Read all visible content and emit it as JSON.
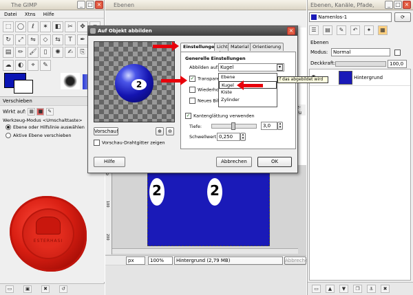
{
  "toolbox": {
    "title": "The GIMP",
    "menu": [
      "Datei",
      "Xtns",
      "Hilfe"
    ],
    "tools": [
      "rect-select",
      "ellipse-select",
      "lasso",
      "fuzzy-select",
      "color-select",
      "scissors",
      "move",
      "crop",
      "rotate",
      "scale",
      "shear",
      "perspective",
      "flip",
      "text",
      "color-picker",
      "bucket-fill",
      "blend",
      "pencil",
      "paintbrush",
      "eraser",
      "airbrush",
      "ink",
      "clone",
      "convolve",
      "smudge",
      "dodge",
      "measure",
      "path"
    ],
    "fg_color": "#0a14b4",
    "bg_color": "#ffffff"
  },
  "tool_options": {
    "title": "Verschieben",
    "affects_label": "Wirkt auf:",
    "tool_mode_label": "Werkzeug-Modus  <Umschalttaste>",
    "option_1": "Ebene oder Hilfslinie auswählen",
    "option_2": "Aktive Ebene verschieben",
    "wax_seal_text": "ESTERHASI"
  },
  "top_window": {
    "title": "Ebenen"
  },
  "dialog": {
    "title": "Auf Objekt abbilden",
    "tabs": [
      "Einstellungen",
      "Licht",
      "Material",
      "Orientierung"
    ],
    "section_heading": "Generelle Einstellungen",
    "map_to_label": "Abbilden auf:",
    "map_to_value": "Kugel",
    "dropdown_options": [
      "Ebene",
      "Kugel",
      "Kiste",
      "Zylinder"
    ],
    "tooltip": "f das abgebildet wird",
    "checkbox_transparent": "Transpare",
    "checkbox_tile": "Wiederhol",
    "checkbox_new_image": "Neues Bild",
    "checkbox_antialias": "Kantenglättung verwenden",
    "depth_label": "Tiefe:",
    "depth_value": "3,0",
    "threshold_label": "Schwellwert:",
    "threshold_value": "0,250",
    "preview_button": "Vorschau!",
    "wireframe_label": "Vorschau-Drahtgitter zeigen",
    "help_button": "Hilfe",
    "cancel_button": "Abbrechen",
    "ok_button": "OK",
    "ball_number": "2"
  },
  "canvas": {
    "ruler_marks": [
      "0",
      "100",
      "200"
    ],
    "ball_1": "2",
    "ball_2": "2",
    "unit": "px",
    "zoom": "100%",
    "status": "Hintergrund (2,79 MB)",
    "cancel": "Abbrechen",
    "bg_color": "#1a1ab8",
    "side_label": "e-Fu"
  },
  "layers": {
    "title": "Ebenen, Kanäle, Pfade,",
    "image_selector": "Namenlos-1",
    "panel_label": "Ebenen",
    "mode_label": "Modus:",
    "mode_value": "Normal",
    "opacity_label": "Deckkraft:",
    "opacity_value": "100,0",
    "layer_name": "Hintergrund"
  }
}
